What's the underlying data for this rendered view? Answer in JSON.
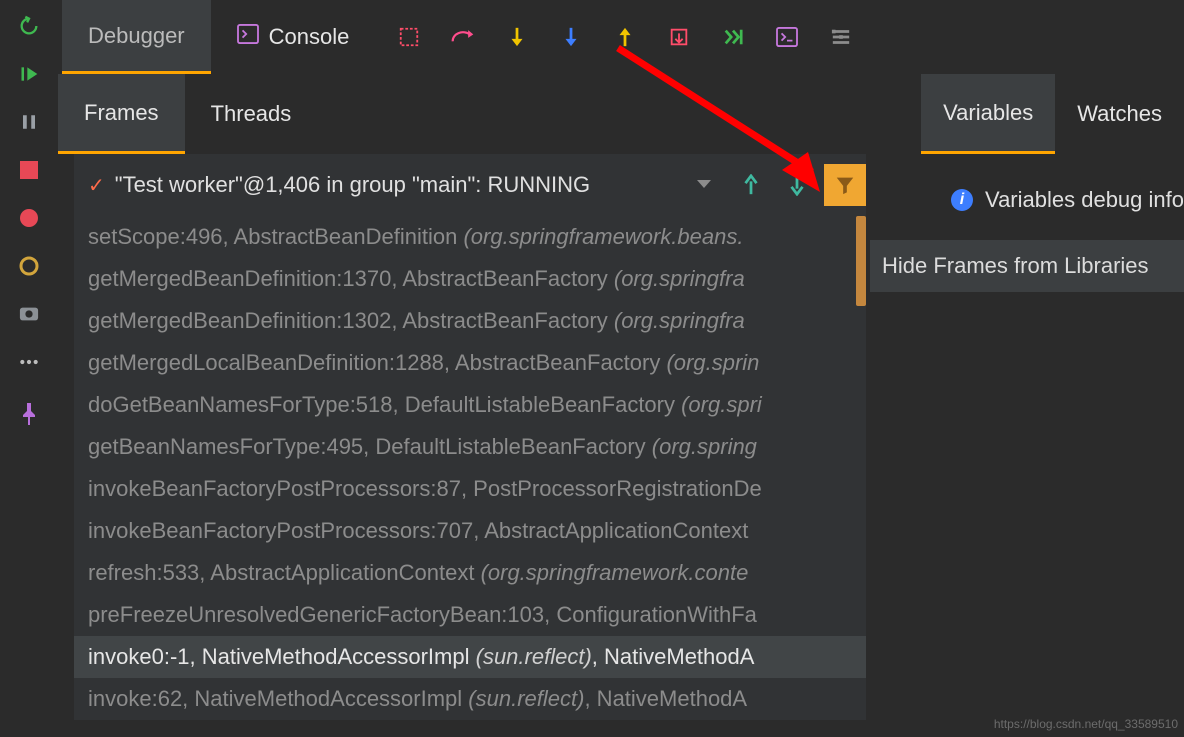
{
  "leftRail": {
    "rerun": "rerun-icon",
    "resume": "resume-icon",
    "pause": "pause-icon",
    "stop": "stop-icon",
    "breakpoints": "breakpoints-icon",
    "muteBreakpoints": "mute-breakpoints-icon",
    "camera": "camera-icon",
    "more": "more-icon",
    "pin": "pin-icon"
  },
  "topTabs": {
    "debugger": "Debugger",
    "console": "Console"
  },
  "toolbar": {
    "frameIcon": "frame-target-icon",
    "stepOver": "step-over-icon",
    "stepIntoBlue": "step-into-icon",
    "forceStepBlue": "force-step-into-icon",
    "stepOut": "step-out-icon",
    "dropFrame": "drop-frame-icon",
    "runToCursor": "run-to-cursor-icon",
    "evalExpr": "evaluate-expression-icon",
    "traceOver": "trace-icon"
  },
  "subTabs": {
    "frames": "Frames",
    "threads": "Threads"
  },
  "rightTabs": {
    "variables": "Variables",
    "watches": "Watches"
  },
  "threadSelector": {
    "text": "\"Test worker\"@1,406 in group \"main\": RUNNING"
  },
  "varInfo": {
    "text": "Variables debug info"
  },
  "tooltip": {
    "hideFrames": "Hide Frames from Libraries"
  },
  "frames": [
    {
      "main": "setScope:496, AbstractBeanDefinition ",
      "pkg": "(org.springframework.beans."
    },
    {
      "main": "getMergedBeanDefinition:1370, AbstractBeanFactory ",
      "pkg": "(org.springfra"
    },
    {
      "main": "getMergedBeanDefinition:1302, AbstractBeanFactory ",
      "pkg": "(org.springfra"
    },
    {
      "main": "getMergedLocalBeanDefinition:1288, AbstractBeanFactory ",
      "pkg": "(org.sprin"
    },
    {
      "main": "doGetBeanNamesForType:518, DefaultListableBeanFactory ",
      "pkg": "(org.spri"
    },
    {
      "main": "getBeanNamesForType:495, DefaultListableBeanFactory ",
      "pkg": "(org.spring"
    },
    {
      "main": "invokeBeanFactoryPostProcessors:87, PostProcessorRegistrationDe",
      "pkg": ""
    },
    {
      "main": "invokeBeanFactoryPostProcessors:707, AbstractApplicationContext ",
      "pkg": ""
    },
    {
      "main": "refresh:533, AbstractApplicationContext ",
      "pkg": "(org.springframework.conte"
    },
    {
      "main": "preFreezeUnresolvedGenericFactoryBean:103, ConfigurationWithFa",
      "pkg": ""
    },
    {
      "main": "invoke0:-1, NativeMethodAccessorImpl ",
      "pkg": "(sun.reflect)",
      "tail": ", NativeMethodA",
      "current": true
    },
    {
      "main": "invoke:62, NativeMethodAccessorImpl ",
      "pkg": "(sun.reflect)",
      "tail": ", NativeMethodA"
    }
  ],
  "watermark": "https://blog.csdn.net/qq_33589510"
}
